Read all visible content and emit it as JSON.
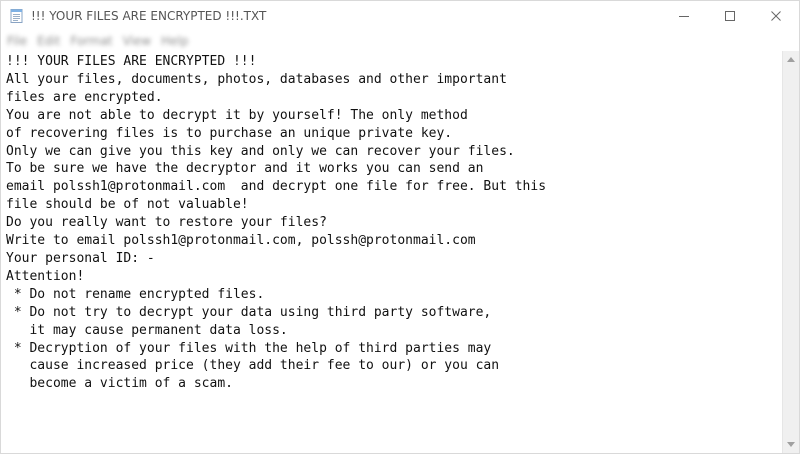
{
  "window": {
    "title": "!!! YOUR FILES ARE ENCRYPTED !!!.TXT"
  },
  "menu": {
    "items": [
      "File",
      "Edit",
      "Format",
      "View",
      "Help"
    ]
  },
  "document": {
    "lines": [
      "!!! YOUR FILES ARE ENCRYPTED !!!",
      "All your files, documents, photos, databases and other important",
      "files are encrypted.",
      "You are not able to decrypt it by yourself! The only method",
      "of recovering files is to purchase an unique private key.",
      "Only we can give you this key and only we can recover your files.",
      "To be sure we have the decryptor and it works you can send an",
      "email polssh1@protonmail.com  and decrypt one file for free. But this",
      "file should be of not valuable!",
      "Do you really want to restore your files?",
      "Write to email polssh1@protonmail.com, polssh@protonmail.com",
      "Your personal ID: -",
      "Attention!",
      " * Do not rename encrypted files.",
      " * Do not try to decrypt your data using third party software,",
      "   it may cause permanent data loss.",
      " * Decryption of your files with the help of third parties may",
      "   cause increased price (they add their fee to our) or you can",
      "   become a victim of a scam."
    ]
  },
  "icons": {
    "app": "notepad-icon",
    "minimize": "minimize-icon",
    "maximize": "maximize-icon",
    "close": "close-icon"
  }
}
